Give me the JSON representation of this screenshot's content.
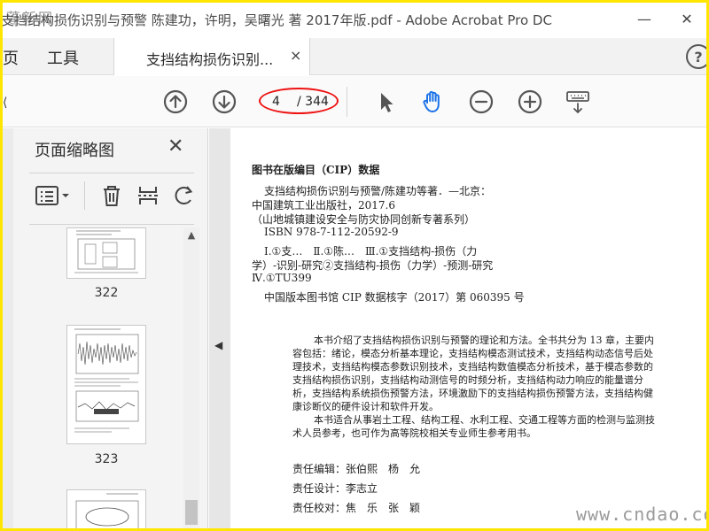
{
  "window": {
    "title": "支挡结构损伤识别与预警 陈建功，许明，吴曙光 著 2017年版.pdf - Adobe Acrobat Pro DC",
    "stamp": "蓬新网",
    "minimize": "—",
    "close": "✕"
  },
  "tabs": {
    "home": "页",
    "tools": "工具",
    "document": "支挡结构损伤识别...",
    "document_close": "×",
    "help": "?"
  },
  "toolbar": {
    "page_current": "4",
    "page_total": "/ 344",
    "icons": [
      "prev-page-icon",
      "next-page-icon",
      "select-arrow-icon",
      "hand-icon",
      "zoom-out-icon",
      "zoom-in-icon",
      "keyboard-scroll-icon"
    ],
    "accent_color": "#1a73e8",
    "annotation_color": "#e11111"
  },
  "sidebar": {
    "title": "页面缩略图",
    "close": "✕",
    "thumbnails": [
      {
        "label": "322"
      },
      {
        "label": "323"
      },
      {
        "label": ""
      }
    ]
  },
  "document": {
    "cip_title": "图书在版编目（CIP）数据",
    "cip_lines": [
      "支挡结构损伤识别与预警/陈建功等著．—北京：",
      "中国建筑工业出版社，2017.6",
      "（山地城镇建设安全与防灾协同创新专著系列）",
      "ISBN 978-7-112-20592-9",
      "Ⅰ.①支…　Ⅱ.①陈…　Ⅲ.①支挡结构-损伤（力",
      "学）-识别-研究②支挡结构-损伤（力学）-预测-研究",
      "Ⅳ.①TU399",
      "中国版本图书馆 CIP 数据核字（2017）第 060395 号"
    ],
    "abstract_p1": "本书介绍了支挡结构损伤识别与预警的理论和方法。全书共分为 13 章，主要内容包括：绪论，模态分析基本理论，支挡结构模态测试技术，支挡结构动态信号后处理技术，支挡结构模态参数识别技术，支挡结构数值模态分析技术，基于模态参数的支挡结构损伤识别，支挡结构动测信号的时频分析，支挡结构动力响应的能量谱分析，支挡结构系统损伤预警方法，环境激励下的支挡结构损伤预警方法，支挡结构健康诊断仪的硬件设计和软件开发。",
    "abstract_p2": "本书适合从事岩土工程、结构工程、水利工程、交通工程等方面的检测与监测技术人员参考，也可作为高等院校相关专业师生参考用书。",
    "credits": [
      "责任编辑：张伯熙　杨　允",
      "责任设计：李志立",
      "责任校对：焦　乐　张　颖"
    ]
  },
  "watermark": "www.cndao.com"
}
